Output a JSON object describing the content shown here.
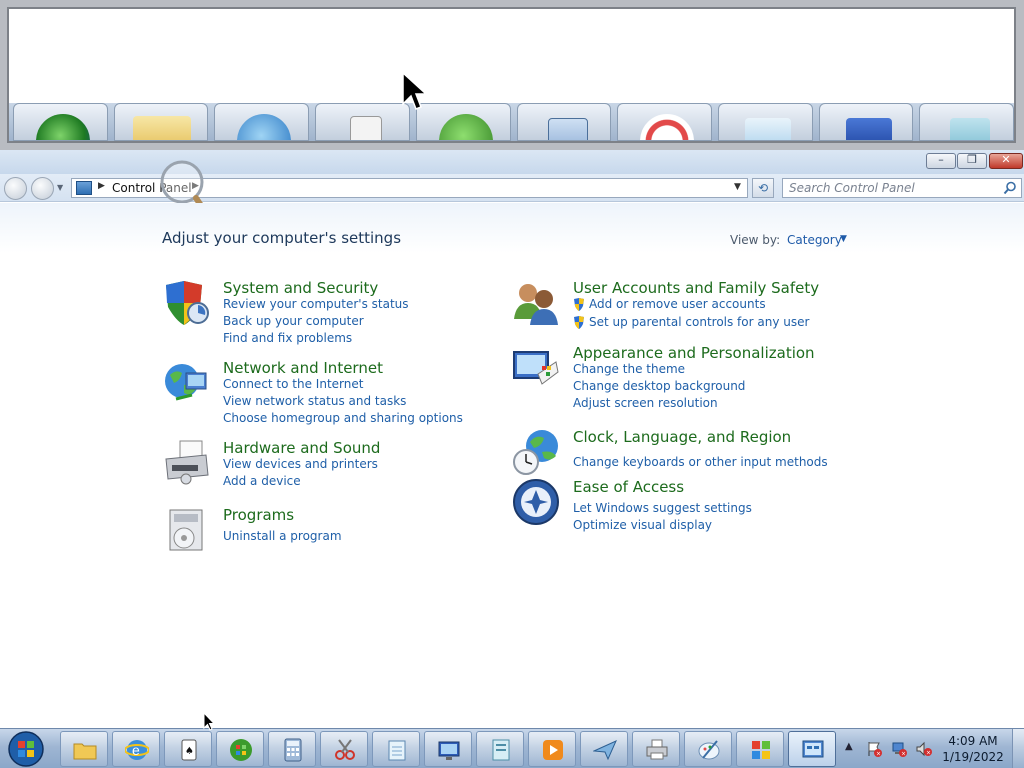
{
  "window": {
    "minimize_label": "–",
    "maximize_label": "❐",
    "close_label": "✕"
  },
  "navbar": {
    "address": "Control Panel",
    "search_placeholder": "Search Control Panel"
  },
  "content": {
    "title": "Adjust your computer's settings",
    "view_by_label": "View by:",
    "view_by_value": "Category"
  },
  "categories": {
    "system": {
      "title": "System and Security",
      "links": [
        "Review your computer's status",
        "Back up your computer",
        "Find and fix problems"
      ],
      "icon": "shield-icon"
    },
    "network": {
      "title": "Network and Internet",
      "links": [
        "Connect to the Internet",
        "View network status and tasks",
        "Choose homegroup and sharing options"
      ],
      "icon": "globe-network-icon"
    },
    "hardware": {
      "title": "Hardware and Sound",
      "links": [
        "View devices and printers",
        "Add a device"
      ],
      "icon": "printer-icon"
    },
    "programs": {
      "title": "Programs",
      "links": [
        "Uninstall a program"
      ],
      "icon": "programs-icon"
    },
    "users": {
      "title": "User Accounts and Family Safety",
      "links": [
        "Add or remove user accounts",
        "Set up parental controls for any user"
      ],
      "icon": "users-icon"
    },
    "appearance": {
      "title": "Appearance and Personalization",
      "links": [
        "Change the theme",
        "Change desktop background",
        "Adjust screen resolution"
      ],
      "icon": "monitor-palette-icon"
    },
    "clock": {
      "title": "Clock, Language, and Region",
      "links": [
        "Change keyboards or other input methods"
      ],
      "icon": "clock-globe-icon"
    },
    "ease": {
      "title": "Ease of Access",
      "links": [
        "Let Windows suggest settings",
        "Optimize visual display"
      ],
      "icon": "ease-of-access-icon"
    }
  },
  "taskbar": {
    "apps": [
      "Windows Explorer",
      "Internet Explorer",
      "Solitaire",
      "Windows Media Center",
      "Calculator",
      "Snipping Tool",
      "Notepad",
      "Remote Desktop",
      "WordPad",
      "Windows Media Player",
      "Fax and Scan",
      "Printer",
      "Paint",
      "Windows Live",
      "Control Panel"
    ],
    "clock_time": "4:09 AM",
    "clock_date": "1/19/2022"
  },
  "colors": {
    "link": "#1f5fa8",
    "category_title": "#1d6b1d",
    "page_title": "#1e395b"
  }
}
